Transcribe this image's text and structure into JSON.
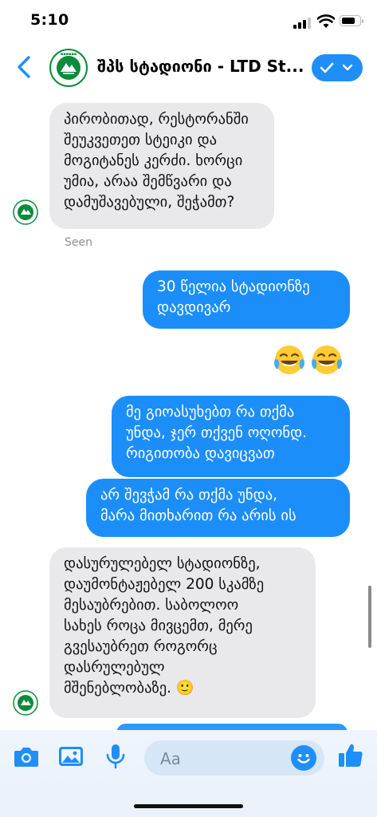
{
  "status_bar": {
    "time": "5:10",
    "battery_level": 0.78
  },
  "header": {
    "title": "შპს სტადიონი - LTD St...",
    "accent_color": "#1f8ef7"
  },
  "messages": [
    {
      "direction": "incoming",
      "text": "პირობითად, რესტორანში\nშეუკვეთეთ სტეიკი და\nმოგიტანეს კერძი. ხორცი\nუმია, არაა შემწვარი და\nდამუშავებული, შეჭამთ?"
    },
    {
      "direction": "outgoing",
      "text": "30 წელია სტადიონზე\nდავდივარ"
    },
    {
      "direction": "outgoing",
      "text": "მე გიოასუხებთ რა თქმა\nუნდა, ჯერ თქვენ ოღონდ.\nრიგითობა დავიცვათ"
    },
    {
      "direction": "outgoing",
      "text": "არ შევჭამ რა თქმა უნდა,\nმარა მითხარით რა არის ის"
    },
    {
      "direction": "incoming",
      "text": "დასურულებელ სტადიონზე,\nდაუმონტაჟებელ 200 სკამზე\nმესაუბრებით. საბოლოო\nსახეს როცა მივცემთ, მერე\nგვესაუბრეთ როგორც\nდასრულებულ\nმშენებლობაზე. 🙂"
    }
  ],
  "seen_label": "Seen",
  "emoji_reaction": [
    "laughing-with-tears",
    "laughing-with-tears"
  ],
  "composer": {
    "placeholder": "Aa"
  },
  "colors": {
    "outgoing_bubble": "#1c8ef9",
    "incoming_bubble": "#e9e9eb",
    "logo_green": "#0e8a3e"
  }
}
